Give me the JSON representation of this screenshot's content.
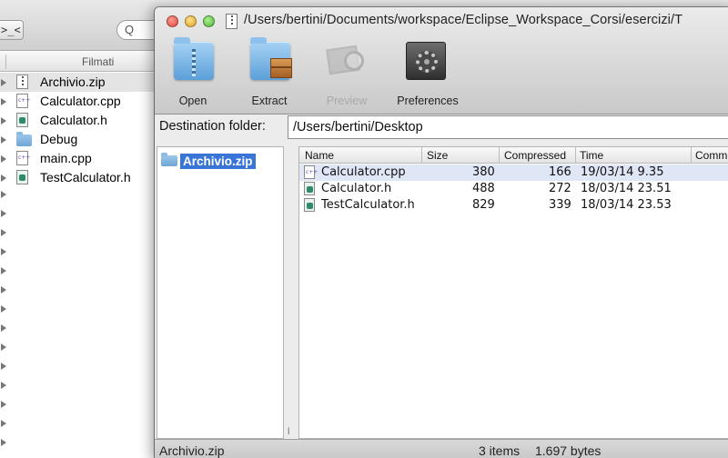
{
  "finder": {
    "column_header": "Filmati",
    "arrange_glyph": ">_<",
    "search_glyph": "Q",
    "items": [
      {
        "name": "Archivio.zip",
        "icon": "zip-file-icon"
      },
      {
        "name": "Calculator.cpp",
        "icon": "cpp-file-icon"
      },
      {
        "name": "Calculator.h",
        "icon": "header-file-icon"
      },
      {
        "name": "Debug",
        "icon": "folder-icon"
      },
      {
        "name": "main.cpp",
        "icon": "cpp-file-icon"
      },
      {
        "name": "TestCalculator.h",
        "icon": "header-file-icon"
      }
    ]
  },
  "archive_window": {
    "title": "/Users/bertini/Documents/workspace/Eclipse_Workspace_Corsi/esercizi/T",
    "toolbar": {
      "open_label": "Open",
      "extract_label": "Extract",
      "preview_label": "Preview",
      "preferences_label": "Preferences"
    },
    "destination": {
      "label": "Destination folder:",
      "value": "/Users/bertini/Desktop"
    },
    "tree": {
      "selected": "Archivio.zip"
    },
    "table": {
      "headers": {
        "name": "Name",
        "size": "Size",
        "compressed": "Compressed",
        "time": "Time",
        "comment": "Comm"
      },
      "rows": [
        {
          "name": "Calculator.cpp",
          "size": "380",
          "compressed": "166",
          "time": "19/03/14 9.35",
          "icon": "cpp-file-icon"
        },
        {
          "name": "Calculator.h",
          "size": "488",
          "compressed": "272",
          "time": "18/03/14 23.51",
          "icon": "header-file-icon"
        },
        {
          "name": "TestCalculator.h",
          "size": "829",
          "compressed": "339",
          "time": "18/03/14 23.53",
          "icon": "header-file-icon"
        }
      ]
    },
    "status": {
      "archive_name": "Archivio.zip",
      "items": "3 items",
      "bytes": "1.697 bytes"
    }
  },
  "colors": {
    "selection_blue": "#3875d7",
    "row_highlight": "#dfe7f6"
  }
}
